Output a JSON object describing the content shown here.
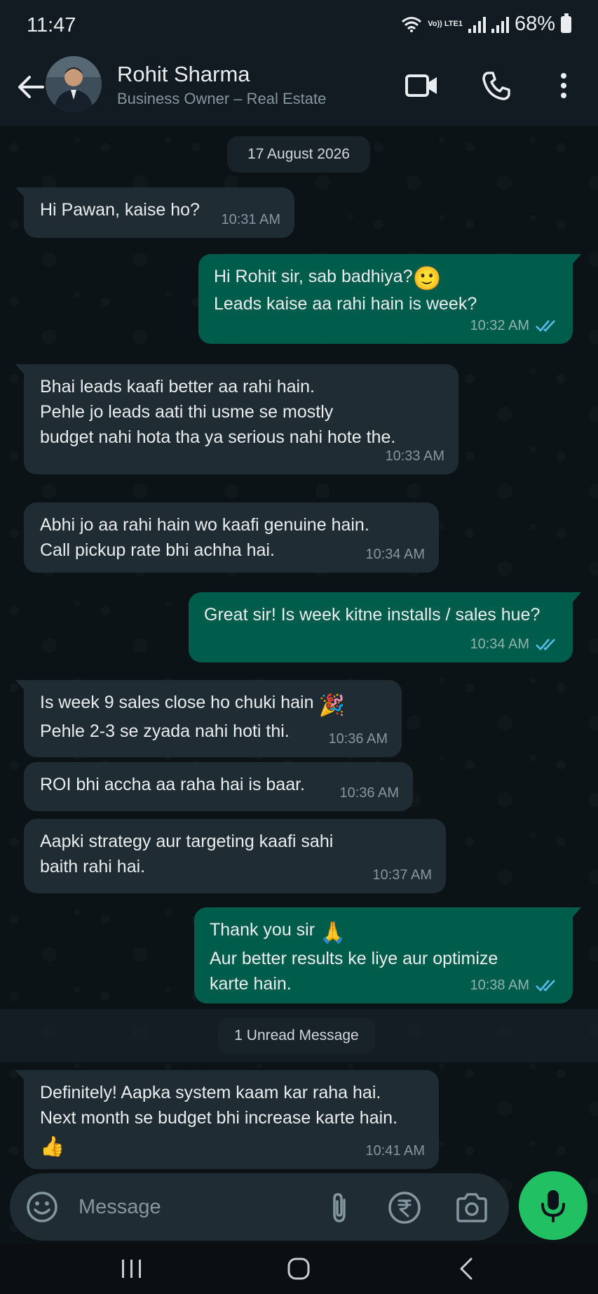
{
  "status_bar": {
    "time": "11:47",
    "network_label": "Vo)) LTE1",
    "battery": "68%"
  },
  "header": {
    "contact_name": "Rohit Sharma",
    "contact_subtitle": "Business Owner – Real Estate",
    "icons": [
      "back-arrow-icon",
      "video-call-icon",
      "voice-call-icon",
      "more-options-icon"
    ]
  },
  "chat": {
    "date_chip": "17 August 2026",
    "unread_chip": "1 Unread Message",
    "messages": [
      {
        "dir": "in",
        "lines": [
          "Hi Pawan, kaise ho?"
        ],
        "time": "10:31 AM"
      },
      {
        "dir": "out",
        "lines": [
          "Hi Rohit sir, sab badhiya?",
          "Leads kaise aa rahi hain is week?"
        ],
        "emoji": "🙂",
        "time": "10:32 AM"
      },
      {
        "dir": "in",
        "lines": [
          "Bhai leads kaafi better aa rahi hain.",
          "Pehle jo leads aati thi usme se mostly",
          "budget nahi hota tha ya serious nahi hote the."
        ],
        "time": "10:33 AM"
      },
      {
        "dir": "in",
        "lines": [
          "Abhi jo aa rahi hain wo kaafi genuine hain.",
          "Call pickup rate bhi achha hai."
        ],
        "time": "10:34 AM"
      },
      {
        "dir": "out",
        "lines": [
          "Great sir! Is week kitne installs / sales hue?"
        ],
        "time": "10:34 AM"
      },
      {
        "dir": "in",
        "lines": [
          "Is week 9 sales close ho chuki hain",
          "Pehle 2-3 se zyada nahi hoti thi."
        ],
        "emoji": "🎉",
        "time": "10:36 AM"
      },
      {
        "dir": "in",
        "lines": [
          "ROI bhi accha aa raha hai is baar."
        ],
        "time": "10:36 AM"
      },
      {
        "dir": "in",
        "lines": [
          "Aapki strategy aur targeting kaafi sahi",
          "baith rahi hai."
        ],
        "time": "10:37 AM"
      },
      {
        "dir": "out",
        "lines": [
          "Thank you sir",
          "Aur better results ke liye aur optimize",
          "karte hain."
        ],
        "emoji": "🙏",
        "time": "10:38 AM"
      },
      {
        "dir": "in",
        "lines": [
          "Definitely! Aapka system kaam kar raha hai.",
          "Next month se budget bhi increase karte hain."
        ],
        "emoji": "👍",
        "time": "10:41 AM"
      }
    ]
  },
  "input": {
    "placeholder": "Message",
    "icons": [
      "emoji-icon",
      "attach-icon",
      "rupee-payment-icon",
      "camera-icon",
      "mic-icon"
    ]
  },
  "colors": {
    "incoming_bubble": "#202c33",
    "outgoing_bubble": "#005c4b",
    "read_ticks": "#53bdeb",
    "mic_button": "#21c063"
  }
}
